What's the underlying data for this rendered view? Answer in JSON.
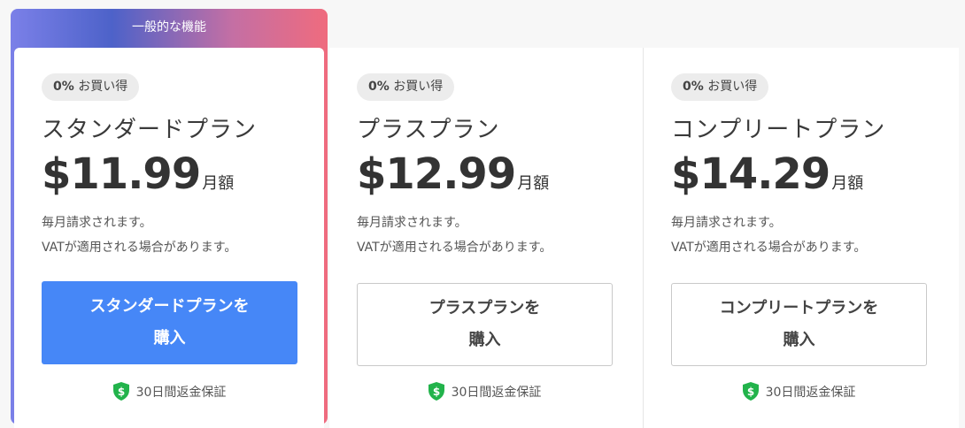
{
  "featured_label": "一般的な機能",
  "plans": [
    {
      "badge_pct": "0%",
      "badge_text": " お買い得",
      "name": "スタンダードプラン",
      "price": "$11.99",
      "unit": "月額",
      "note_1": "毎月請求されます。",
      "note_2": "VATが適用される場合があります。",
      "button_line_1": "スタンダードプランを",
      "button_line_2": "購入",
      "guarantee": "30日間返金保証"
    },
    {
      "badge_pct": "0%",
      "badge_text": " お買い得",
      "name": "プラスプラン",
      "price": "$12.99",
      "unit": "月額",
      "note_1": "毎月請求されます。",
      "note_2": "VATが適用される場合があります。",
      "button_line_1": "プラスプランを",
      "button_line_2": "購入",
      "guarantee": "30日間返金保証"
    },
    {
      "badge_pct": "0%",
      "badge_text": " お買い得",
      "name": "コンプリートプラン",
      "price": "$14.29",
      "unit": "月額",
      "note_1": "毎月請求されます。",
      "note_2": "VATが適用される場合があります。",
      "button_line_1": "コンプリートプランを",
      "button_line_2": "購入",
      "guarantee": "30日間返金保証"
    }
  ],
  "colors": {
    "primary_button": "#4687f7",
    "shield": "#22b34b",
    "featured_gradient_start": "#7b80e8",
    "featured_gradient_end": "#ef6b7e"
  }
}
